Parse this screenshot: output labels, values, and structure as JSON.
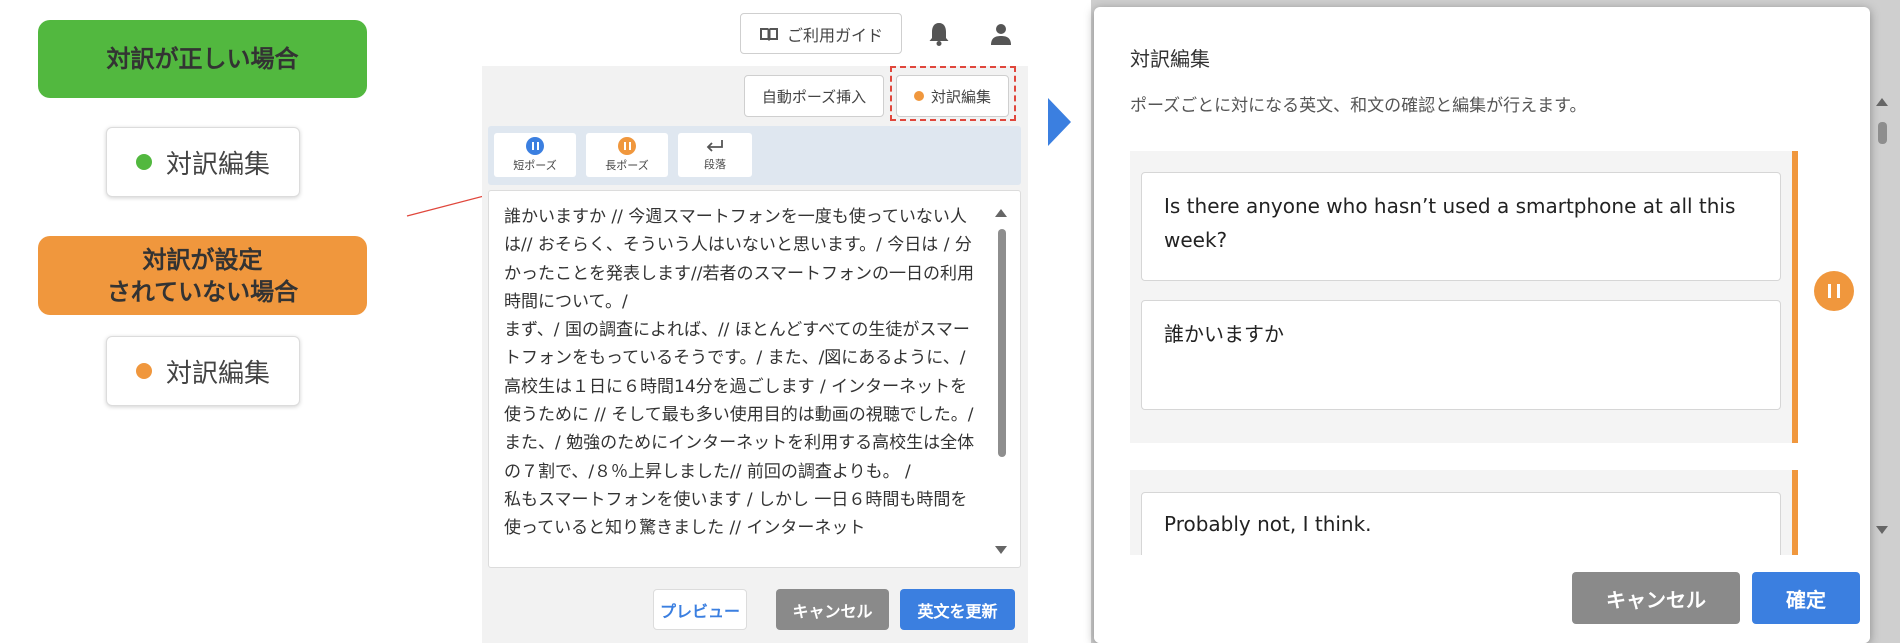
{
  "legend": {
    "correct_label": "対訳が正しい場合",
    "unset_label_line1": "対訳が設定",
    "unset_label_line2": "されていない場合",
    "chip_label": "対訳編集",
    "color_green": "#52b83f",
    "color_orange": "#f0973d"
  },
  "editor": {
    "guide_label": "ご利用ガイド",
    "guide_icon": "book-icon",
    "bell_icon": "bell-icon",
    "user_icon": "user-icon",
    "auto_pause_label": "自動ポーズ挿入",
    "translation_edit_label": "対訳編集",
    "tools": [
      {
        "label": "短ポーズ",
        "icon": "pause-blue-icon"
      },
      {
        "label": "長ポーズ",
        "icon": "pause-orange-icon"
      },
      {
        "label": "段落",
        "icon": "return-arrow-icon"
      }
    ],
    "body_text": "誰かいますか // 今週スマートフォンを一度も使っていない人は// おそらく、そういう人はいないと思います。/ 今日は / 分かったことを発表します//若者のスマートフォンの一日の利用時間について。/\nまず、/ 国の調査によれば、// ほとんどすべての生徒がスマートフォンをもっているそうです。/ また、/図にあるように、/ 高校生は１日に６時間14分を過ごします / インターネットを使うために // そして最も多い使用目的は動画の視聴でした。/ また、/ 勉強のためにインターネットを利用する高校生は全体の７割で、/８％上昇しました// 前回の調査よりも。 /\n私もスマートフォンを使います / しかし 一日６時間も時間を使っていると知り驚きました // インターネット",
    "preview_label": "プレビュー",
    "cancel_label": "キャンセル",
    "update_label": "英文を更新"
  },
  "modal": {
    "title": "対訳編集",
    "description": "ポーズごとに対になる英文、和文の確認と編集が行えます。",
    "pairs": [
      {
        "english": "Is there anyone  who hasn’t used a smartphone at all this week?",
        "japanese": "誰かいますか"
      },
      {
        "english": "Probably not, I think.",
        "japanese": ""
      }
    ],
    "cancel_label": "キャンセル",
    "confirm_label": "確定",
    "accent_color": "#f0973d",
    "primary_color": "#3b7fe0"
  }
}
